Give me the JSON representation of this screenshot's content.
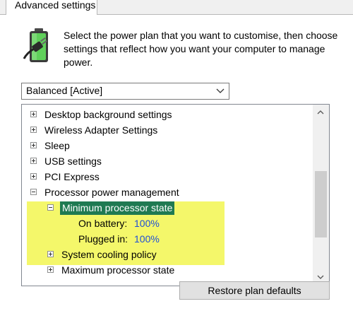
{
  "tab": {
    "label": "Advanced settings"
  },
  "intro": {
    "text": "Select the power plan that you want to customise, then choose settings that reflect how you want your computer to manage power."
  },
  "plan_select": {
    "selected": "Balanced [Active]"
  },
  "tree": {
    "items": [
      {
        "label": "Desktop background settings",
        "expander": "plus"
      },
      {
        "label": "Wireless Adapter Settings",
        "expander": "plus"
      },
      {
        "label": "Sleep",
        "expander": "plus"
      },
      {
        "label": "USB settings",
        "expander": "plus"
      },
      {
        "label": "PCI Express",
        "expander": "plus"
      },
      {
        "label": "Processor power management",
        "expander": "minus"
      },
      {
        "label": "Minimum processor state",
        "expander": "minus",
        "selected": true
      },
      {
        "label": "On battery:",
        "value": "100%"
      },
      {
        "label": "Plugged in:",
        "value": "100%"
      },
      {
        "label": "System cooling policy",
        "expander": "plus"
      },
      {
        "label": "Maximum processor state",
        "expander": "plus"
      }
    ]
  },
  "buttons": {
    "restore": "Restore plan defaults"
  },
  "icons": {
    "battery": "battery-plug-icon",
    "dropdown": "chevron-down-icon",
    "scroll_up": "chevron-up-icon",
    "scroll_down": "chevron-down-icon"
  },
  "colors": {
    "highlight": "#f4f76a",
    "selection": "#1f7a52",
    "value_text": "#1f4fd6"
  }
}
